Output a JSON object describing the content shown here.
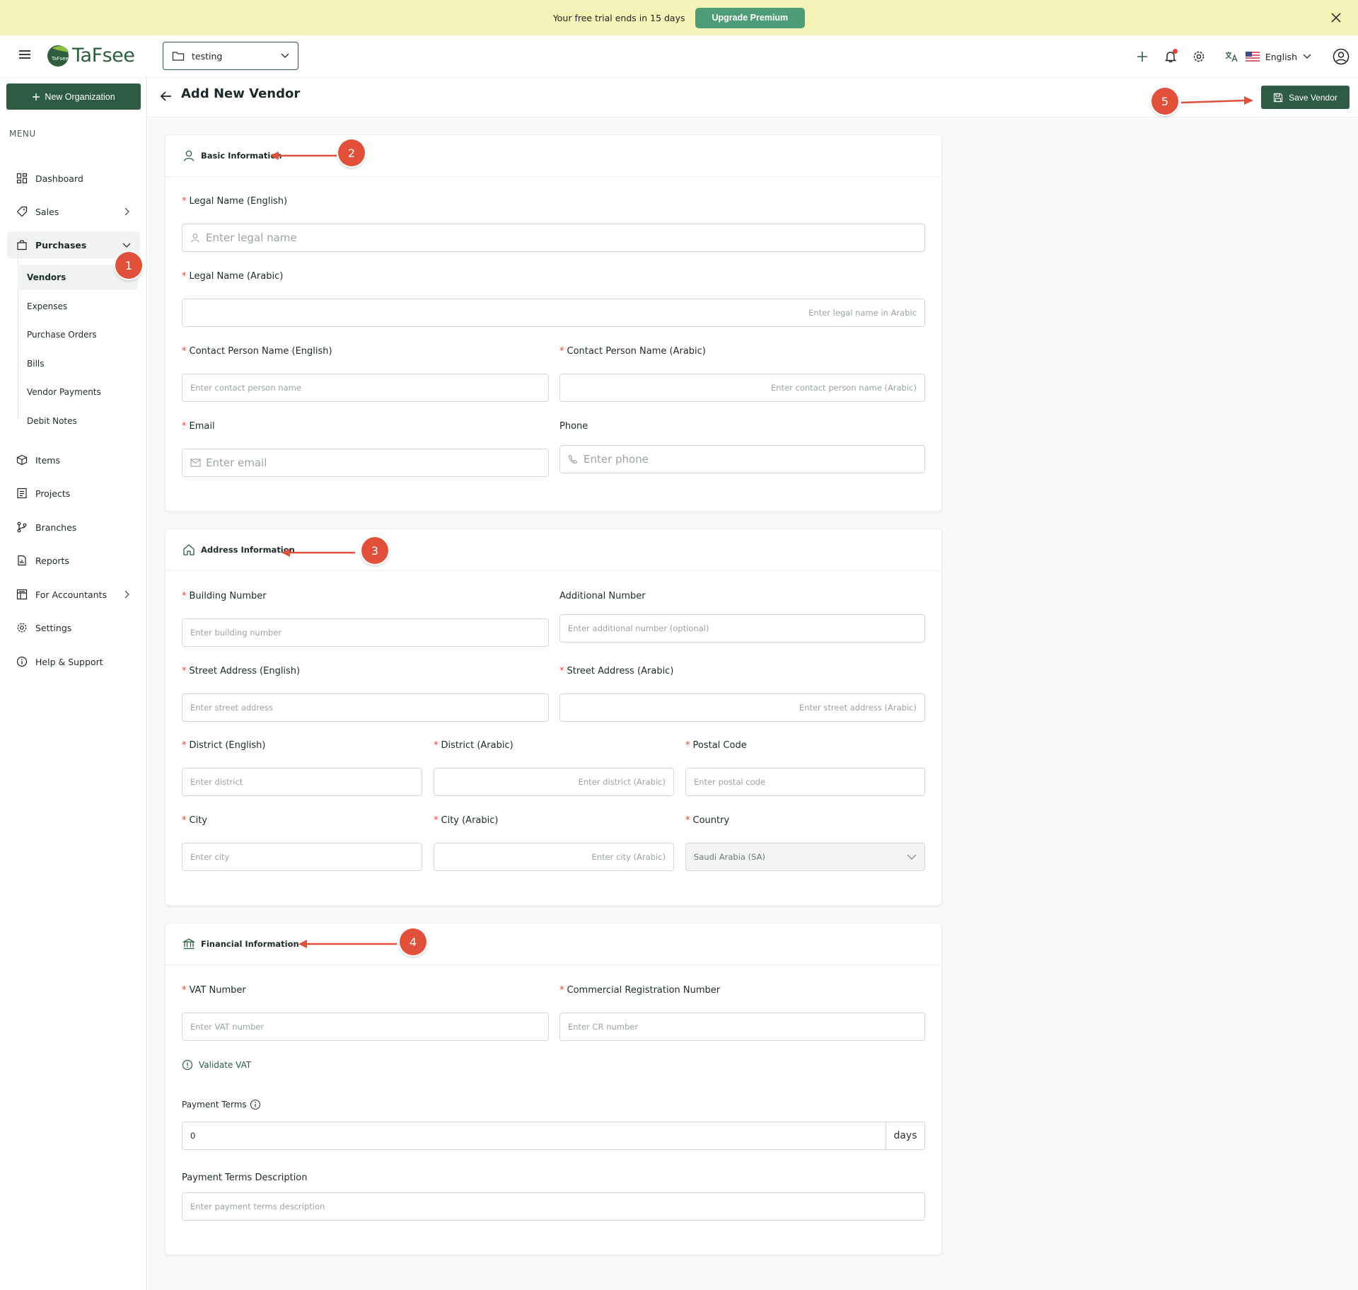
{
  "banner": {
    "text": "Your free trial ends in 15 days",
    "upgrade_label": "Upgrade Premium"
  },
  "header": {
    "logo_text": "TaFsee",
    "logo_mark_text": "TaFsee",
    "org_selector": "testing",
    "language": "English"
  },
  "sidebar": {
    "new_org_label": "New Organization",
    "menu_label": "MENU",
    "items": [
      {
        "label": "Dashboard"
      },
      {
        "label": "Sales"
      },
      {
        "label": "Purchases"
      },
      {
        "label": "Items"
      },
      {
        "label": "Projects"
      },
      {
        "label": "Branches"
      },
      {
        "label": "Reports"
      },
      {
        "label": "For Accountants"
      },
      {
        "label": "Settings"
      },
      {
        "label": "Help & Support"
      }
    ],
    "purchases_sub": [
      {
        "label": "Vendors"
      },
      {
        "label": "Expenses"
      },
      {
        "label": "Purchase Orders"
      },
      {
        "label": "Bills"
      },
      {
        "label": "Vendor Payments"
      },
      {
        "label": "Debit Notes"
      }
    ]
  },
  "page": {
    "title": "Add New Vendor",
    "save_label": "Save Vendor"
  },
  "basic": {
    "title": "Basic Information",
    "legal_name_en": {
      "label": "Legal Name (English)",
      "placeholder": "Enter legal name"
    },
    "legal_name_ar": {
      "label": "Legal Name (Arabic)",
      "placeholder": "Enter legal name in Arabic"
    },
    "contact_en": {
      "label": "Contact Person Name (English)",
      "placeholder": "Enter contact person name"
    },
    "contact_ar": {
      "label": "Contact Person Name (Arabic)",
      "placeholder": "Enter contact person name (Arabic)"
    },
    "email": {
      "label": "Email",
      "placeholder": "Enter email"
    },
    "phone": {
      "label": "Phone",
      "placeholder": "Enter phone"
    }
  },
  "address": {
    "title": "Address Information",
    "building": {
      "label": "Building Number",
      "placeholder": "Enter building number"
    },
    "additional": {
      "label": "Additional Number",
      "placeholder": "Enter additional number (optional)"
    },
    "street_en": {
      "label": "Street Address (English)",
      "placeholder": "Enter street address"
    },
    "street_ar": {
      "label": "Street Address (Arabic)",
      "placeholder": "Enter street address (Arabic)"
    },
    "district_en": {
      "label": "District (English)",
      "placeholder": "Enter district"
    },
    "district_ar": {
      "label": "District (Arabic)",
      "placeholder": "Enter district (Arabic)"
    },
    "postal": {
      "label": "Postal Code",
      "placeholder": "Enter postal code"
    },
    "city": {
      "label": "City",
      "placeholder": "Enter city"
    },
    "city_ar": {
      "label": "City (Arabic)",
      "placeholder": "Enter city (Arabic)"
    },
    "country": {
      "label": "Country",
      "value": "Saudi Arabia (SA)"
    }
  },
  "financial": {
    "title": "Financial Information",
    "vat": {
      "label": "VAT Number",
      "placeholder": "Enter VAT number"
    },
    "cr": {
      "label": "Commercial Registration Number",
      "placeholder": "Enter CR number"
    },
    "validate_label": "Validate VAT",
    "payment_terms": {
      "label": "Payment Terms",
      "value": "0",
      "suffix": "days"
    },
    "payment_desc": {
      "label": "Payment Terms Description",
      "placeholder": "Enter payment terms description"
    }
  },
  "annotations": [
    "1",
    "2",
    "3",
    "4",
    "5"
  ],
  "colors": {
    "brand": "#2e5b44",
    "banner_bg": "#f5f3b8",
    "upgrade": "#4f9d76",
    "required": "#e1473a",
    "callout": "#e0503a"
  }
}
